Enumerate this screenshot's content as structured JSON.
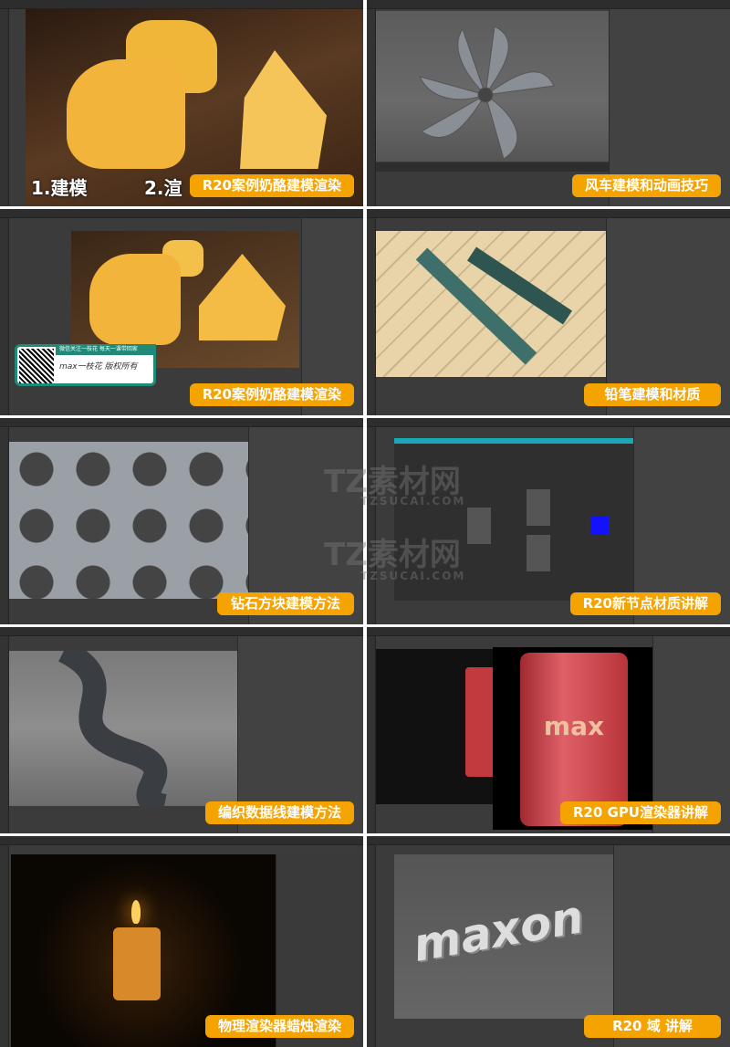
{
  "tiles": [
    {
      "label": "R20案例奶酪建模渲染",
      "overlay_left": "1.建模",
      "overlay_right": "2.渲"
    },
    {
      "label": "风车建模和动画技巧"
    },
    {
      "label": "R20案例奶酪建模渲染",
      "qr_banner": {
        "top": "微信关注一枝花   每天一课带回家",
        "brand": "max一枝花  版权所有"
      }
    },
    {
      "label": "铅笔建模和材质"
    },
    {
      "label": "钻石方块建模方法"
    },
    {
      "label": "R20新节点材质讲解"
    },
    {
      "label": "编织数据线建模方法"
    },
    {
      "label": "R20 GPU渲染器讲解",
      "can_text": "max"
    },
    {
      "label": "物理渲染器蜡烛渲染"
    },
    {
      "label": "R20 域 讲解",
      "viewport_text": "maxon"
    }
  ],
  "watermark": {
    "name": "TZ素材网",
    "url": "TZSUCAI.COM"
  },
  "colors": {
    "label_bg": "#f5a300",
    "ui_bg": "#3b3b3b"
  }
}
